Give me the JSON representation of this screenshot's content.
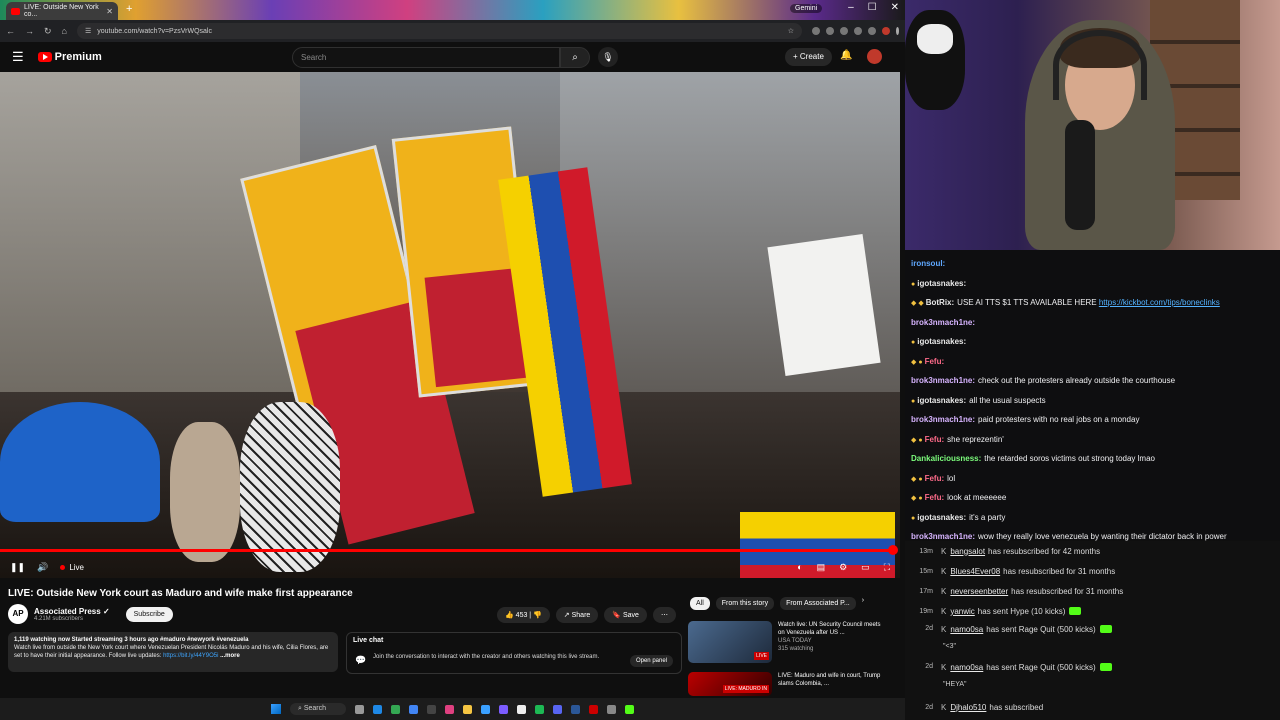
{
  "browser": {
    "tab_title": "LIVE: Outside New York co...",
    "gemini_label": "Gemini",
    "url": "youtube.com/watch?v=PzsVrWQsalc"
  },
  "youtube": {
    "logo_text": "Premium",
    "search_placeholder": "Search",
    "create_label": "Create"
  },
  "player": {
    "live_label": "Live",
    "progress": 1.0
  },
  "video": {
    "title": "LIVE: Outside New York court as Maduro and wife make first appearance",
    "channel": "Associated Press",
    "channel_avatar": "AP",
    "subscribers": "4.21M subscribers",
    "subscribe_label": "Subscribe",
    "likes": "453",
    "share_label": "Share",
    "save_label": "Save",
    "description_meta": "1,119 watching now  Started streaming 3 hours ago  #maduro #newyork #venezuela",
    "description_text": "Watch live from outside the New York court where Venezuelan President Nicolás Maduro and his wife, Cilia Flores, are set to have their initial appearance. Follow live updates: ",
    "description_link": "https://bit.ly/44Y9O5i",
    "description_more": "...more"
  },
  "livechat_box": {
    "title": "Live chat",
    "message": "Join the conversation to interact with the creator and others watching this live stream.",
    "open_label": "Open panel"
  },
  "related": {
    "chips": [
      "All",
      "From this story",
      "From Associated P..."
    ],
    "items": [
      {
        "title": "Watch live: UN Security Council meets on Venezuela after US ...",
        "channel": "USA TODAY",
        "meta": "315 watching",
        "badge": "LIVE"
      },
      {
        "title": "LIVE: Maduro and wife in court, Trump slams Colombia, ...",
        "channel": "",
        "meta": "",
        "badge": "LIVE: MADURO IN"
      }
    ]
  },
  "taskbar": {
    "search_label": "Search"
  },
  "chat": [
    {
      "user": "ironsoul:",
      "color": "#5fa8ff",
      "text": "",
      "badges": ""
    },
    {
      "user": "igotasnakes:",
      "color": "#e8e8e8",
      "text": "",
      "badges": "●"
    },
    {
      "user": "BotRix:",
      "color": "#e8e8e8",
      "text": "USE AI TTS $1 TTS AVAILABLE HERE ",
      "link": "https://kickbot.com/tips/boneclinks",
      "badges": "◆ ◆"
    },
    {
      "user": "brok3nmach1ne:",
      "color": "#d7b4ff",
      "text": "",
      "badges": ""
    },
    {
      "user": "igotasnakes:",
      "color": "#e8e8e8",
      "text": "",
      "badges": "●"
    },
    {
      "user": "Fefu:",
      "color": "#ff6b8a",
      "text": "",
      "badges": "◆ ●"
    },
    {
      "user": "brok3nmach1ne:",
      "color": "#d7b4ff",
      "text": "check out the protesters already outside the courthouse",
      "badges": ""
    },
    {
      "user": "igotasnakes:",
      "color": "#e8e8e8",
      "text": "all the usual suspects",
      "badges": "●"
    },
    {
      "user": "brok3nmach1ne:",
      "color": "#d7b4ff",
      "text": "paid protesters with no real jobs on a monday",
      "badges": ""
    },
    {
      "user": "Fefu:",
      "color": "#ff6b8a",
      "text": "she reprezentin'",
      "badges": "◆ ●"
    },
    {
      "user": "Dankaliciousness:",
      "color": "#7cfc7c",
      "text": "the retarded soros victims out strong today lmao",
      "badges": ""
    },
    {
      "user": "Fefu:",
      "color": "#ff6b8a",
      "text": "lol",
      "badges": "◆ ●"
    },
    {
      "user": "Fefu:",
      "color": "#ff6b8a",
      "text": "look at meeeeee",
      "badges": "◆ ●"
    },
    {
      "user": "igotasnakes:",
      "color": "#e8e8e8",
      "text": "it's a party",
      "badges": "●"
    },
    {
      "user": "brok3nmach1ne:",
      "color": "#d7b4ff",
      "text": "wow they really love venezuela by wanting their dictator back in power",
      "badges": ""
    }
  ],
  "events": [
    {
      "ago": "13m",
      "user": "bangsalot",
      "text": "has resubscribed for 42 months",
      "sub": "",
      "kick": false
    },
    {
      "ago": "15m",
      "user": "Blues4Ever08",
      "text": "has resubscribed for 31 months",
      "sub": "",
      "kick": false
    },
    {
      "ago": "17m",
      "user": "neverseenbetter",
      "text": "has resubscribed for 31 months",
      "sub": "",
      "kick": false
    },
    {
      "ago": "19m",
      "user": "yanwic",
      "text": "has sent Hype (10 kicks)",
      "sub": "",
      "kick": true
    },
    {
      "ago": "2d",
      "user": "namo0sa",
      "text": "has sent Rage Quit (500 kicks)",
      "sub": "\"<3\"",
      "kick": true
    },
    {
      "ago": "2d",
      "user": "namo0sa",
      "text": "has sent Rage Quit (500 kicks)",
      "sub": "\"HEYA\"",
      "kick": true
    },
    {
      "ago": "2d",
      "user": "Djhalo510",
      "text": "has subscribed",
      "sub": "",
      "kick": false
    }
  ]
}
